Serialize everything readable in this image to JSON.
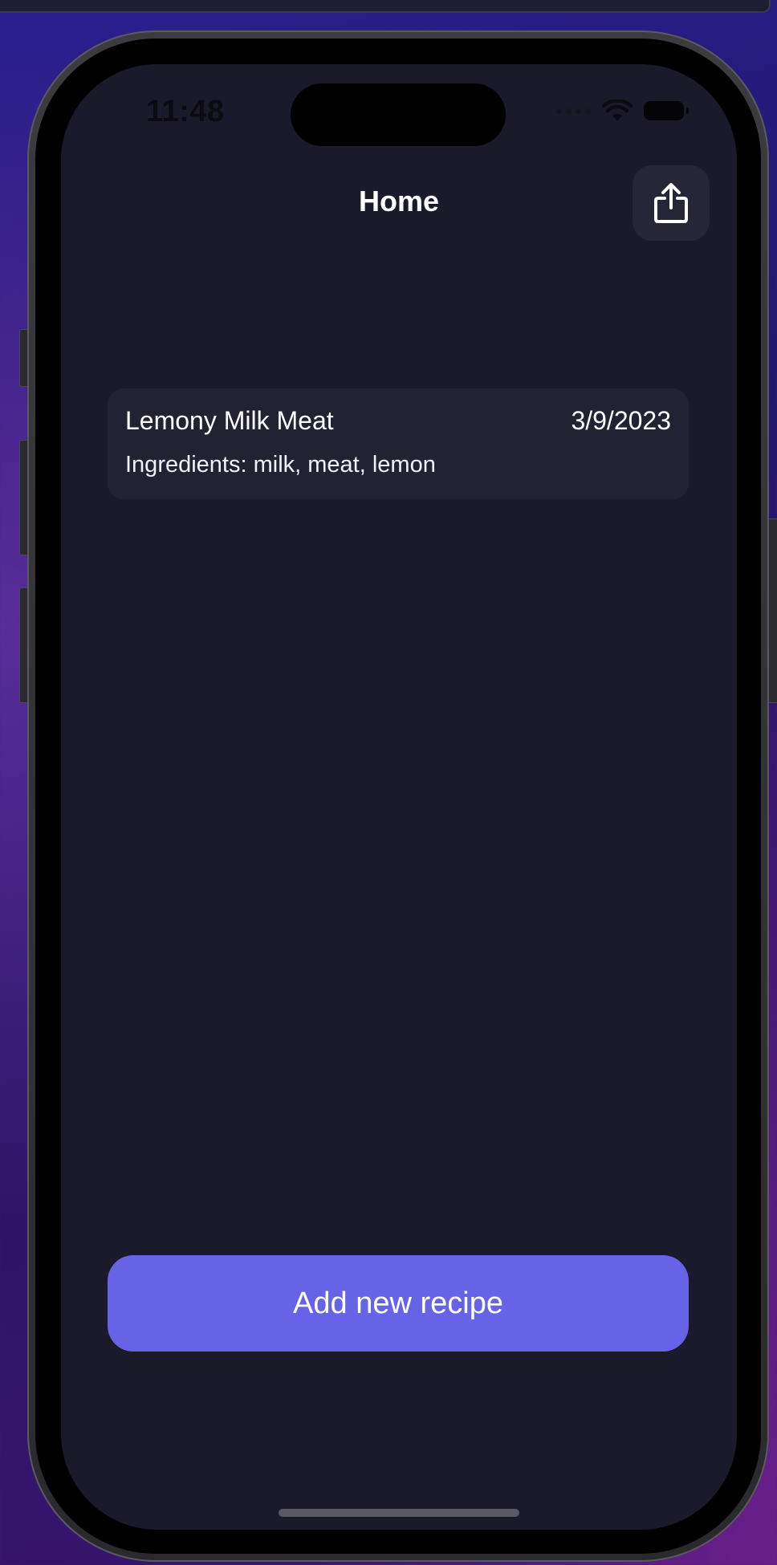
{
  "status_bar": {
    "time": "11:48",
    "wifi_icon": "wifi-icon",
    "battery_icon": "battery-icon"
  },
  "navigation": {
    "title": "Home",
    "share_icon": "share-icon"
  },
  "recipes": [
    {
      "title": "Lemony Milk Meat",
      "date": "3/9/2023",
      "ingredients": "Ingredients: milk, meat, lemon"
    }
  ],
  "actions": {
    "add_recipe_label": "Add new recipe"
  },
  "colors": {
    "screen_background": "#1b1a2b",
    "card_background": "#232233",
    "accent": "#6763e7",
    "text": "#ffffff"
  }
}
